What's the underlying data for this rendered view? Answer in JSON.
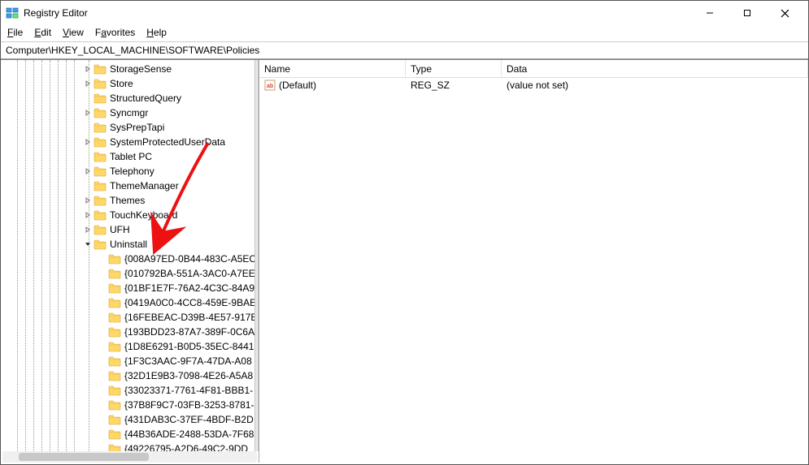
{
  "window": {
    "title": "Registry Editor"
  },
  "menu": {
    "file": "File",
    "edit": "Edit",
    "view": "View",
    "favorites": "Favorites",
    "help": "Help"
  },
  "address": "Computer\\HKEY_LOCAL_MACHINE\\SOFTWARE\\Policies",
  "tree": {
    "items": [
      {
        "indent": 100,
        "chev": "right",
        "label": "StorageSense"
      },
      {
        "indent": 100,
        "chev": "right",
        "label": "Store"
      },
      {
        "indent": 100,
        "chev": "none",
        "label": "StructuredQuery"
      },
      {
        "indent": 100,
        "chev": "right",
        "label": "Syncmgr"
      },
      {
        "indent": 100,
        "chev": "none",
        "label": "SysPrepTapi"
      },
      {
        "indent": 100,
        "chev": "right",
        "label": "SystemProtectedUserData"
      },
      {
        "indent": 100,
        "chev": "none",
        "label": "Tablet PC"
      },
      {
        "indent": 100,
        "chev": "right",
        "label": "Telephony"
      },
      {
        "indent": 100,
        "chev": "none",
        "label": "ThemeManager"
      },
      {
        "indent": 100,
        "chev": "right",
        "label": "Themes"
      },
      {
        "indent": 100,
        "chev": "right",
        "label": "TouchKeyboard"
      },
      {
        "indent": 100,
        "chev": "right",
        "label": "UFH"
      },
      {
        "indent": 100,
        "chev": "down",
        "label": "Uninstall"
      },
      {
        "indent": 118,
        "chev": "none",
        "label": "{008A97ED-0B44-483C-A5EC"
      },
      {
        "indent": 118,
        "chev": "none",
        "label": "{010792BA-551A-3AC0-A7EE"
      },
      {
        "indent": 118,
        "chev": "none",
        "label": "{01BF1E7F-76A2-4C3C-84A9"
      },
      {
        "indent": 118,
        "chev": "none",
        "label": "{0419A0C0-4CC8-459E-9BAE"
      },
      {
        "indent": 118,
        "chev": "none",
        "label": "{16FEBEAC-D39B-4E57-917E"
      },
      {
        "indent": 118,
        "chev": "none",
        "label": "{193BDD23-87A7-389F-0C6A"
      },
      {
        "indent": 118,
        "chev": "none",
        "label": "{1D8E6291-B0D5-35EC-8441"
      },
      {
        "indent": 118,
        "chev": "none",
        "label": "{1F3C3AAC-9F7A-47DA-A08"
      },
      {
        "indent": 118,
        "chev": "none",
        "label": "{32D1E9B3-7098-4E26-A5A8"
      },
      {
        "indent": 118,
        "chev": "none",
        "label": "{33023371-7761-4F81-BBB1-"
      },
      {
        "indent": 118,
        "chev": "none",
        "label": "{37B8F9C7-03FB-3253-8781-"
      },
      {
        "indent": 118,
        "chev": "none",
        "label": "{431DAB3C-37EF-4BDF-B2D"
      },
      {
        "indent": 118,
        "chev": "none",
        "label": "{44B36ADE-2488-53DA-7F68"
      },
      {
        "indent": 118,
        "chev": "none",
        "label": "{49226795-A2D6-49C2-9DD"
      }
    ],
    "vlines": [
      20,
      30,
      40,
      50,
      60,
      70,
      80,
      90,
      108
    ]
  },
  "list": {
    "columns": {
      "name": "Name",
      "type": "Type",
      "data": "Data"
    },
    "rows": [
      {
        "name": "(Default)",
        "type": "REG_SZ",
        "data": "(value not set)"
      }
    ]
  }
}
